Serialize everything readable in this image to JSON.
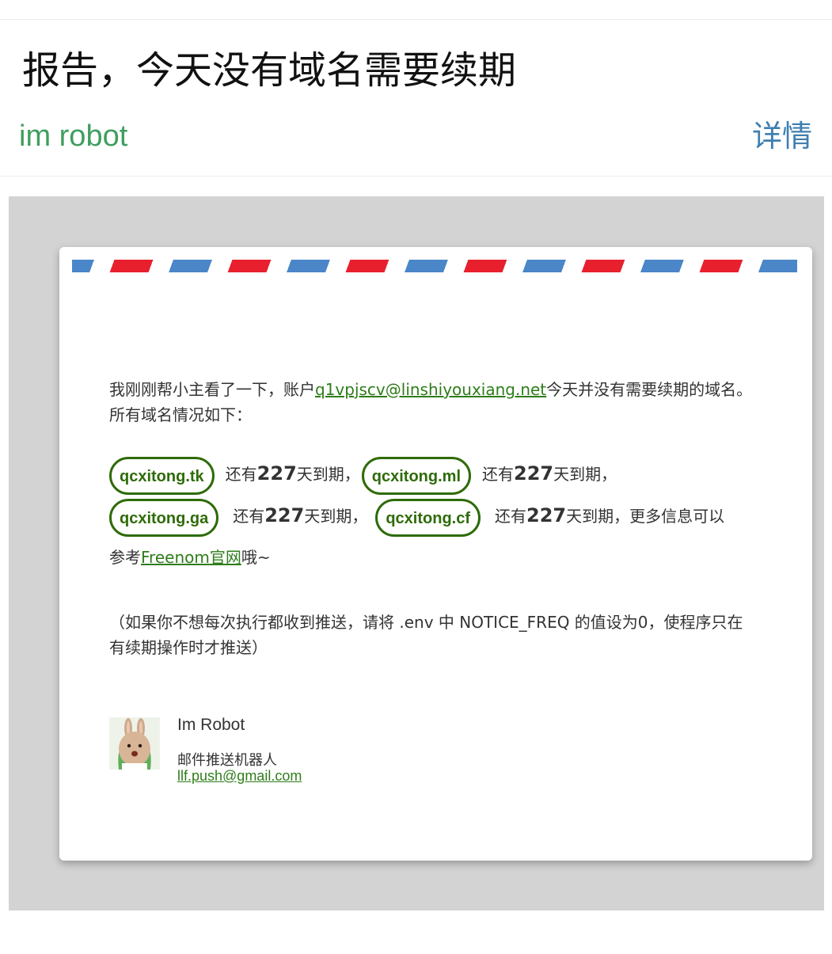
{
  "header": {
    "subject": "报告，今天没有域名需要续期",
    "sender": "im robot",
    "details_label": "详情"
  },
  "colors": {
    "sender": "#3f9e5e",
    "details": "#3f7fb0",
    "link": "#2e7d1a",
    "pill": "#2e6b08",
    "airmail_blue": "#4a86c8",
    "airmail_red": "#e8202e",
    "stage_bg": "#d3d3d3"
  },
  "letter": {
    "intro_before": "我刚刚帮小主看了一下，账户",
    "account_email": "q1vpjscv@linshiyouxiang.net",
    "intro_after": "今天并没有需要续期的域名。所有域名情况如下：",
    "domains": [
      {
        "name": "qcxitong.tk",
        "prefix": "还有",
        "days": "227",
        "suffix": "天到期，"
      },
      {
        "name": "qcxitong.ml",
        "prefix": "还有",
        "days": "227",
        "suffix": "天到期，"
      },
      {
        "name": "qcxitong.ga",
        "prefix": "还有",
        "days": "227",
        "suffix": "天到期，"
      },
      {
        "name": "qcxitong.cf",
        "prefix": "还有",
        "days": "227",
        "suffix": "天到期，更多信息可以"
      }
    ],
    "more_prefix": "参考",
    "freenom_link": "Freenom官网",
    "more_suffix": "哦~",
    "note": "（如果你不想每次执行都收到推送，请将 .env 中 NOTICE_FREQ 的值设为0，使程序只在有续期操作时才推送）"
  },
  "signature": {
    "avatar_icon": "rabbit-avatar-icon",
    "name": "Im Robot",
    "title": "邮件推送机器人",
    "email": "llf.push@gmail.com"
  }
}
